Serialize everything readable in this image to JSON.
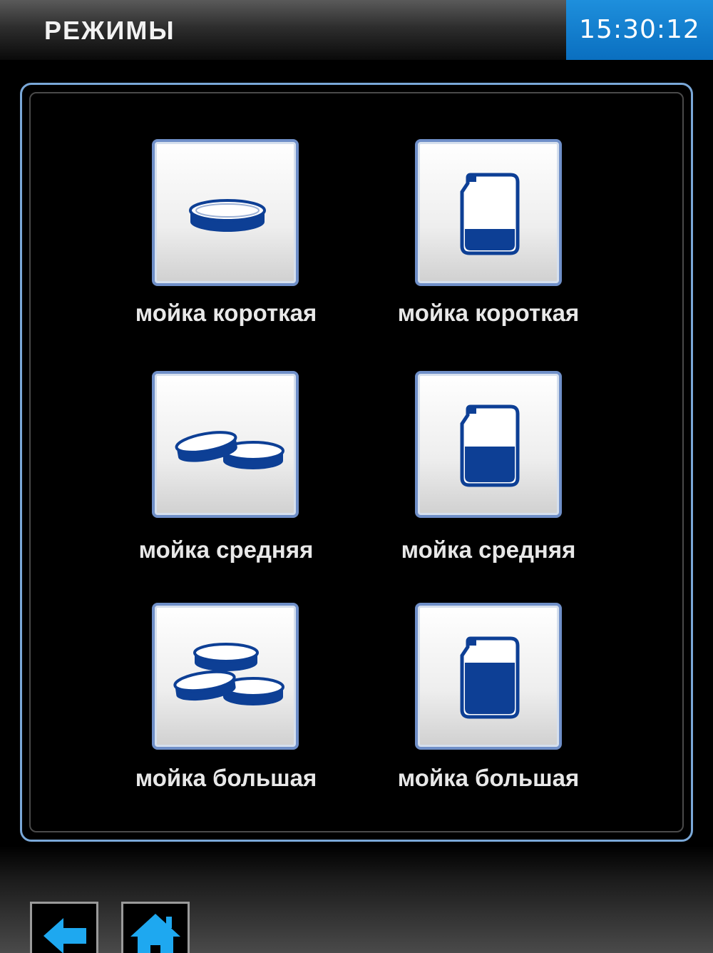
{
  "header": {
    "title": "РЕЖИМЫ",
    "clock": "15:30:12"
  },
  "modes": [
    {
      "label": "мойка короткая",
      "icon": "single-dish-icon"
    },
    {
      "label": "мойка короткая",
      "icon": "canister-low-icon"
    },
    {
      "label": "мойка средняя",
      "icon": "two-dishes-icon"
    },
    {
      "label": "мойка средняя",
      "icon": "canister-half-icon"
    },
    {
      "label": "мойка большая",
      "icon": "three-dishes-icon"
    },
    {
      "label": "мойка большая",
      "icon": "canister-full-icon"
    }
  ],
  "footer": {
    "back_icon": "back-arrow-icon",
    "home_icon": "home-icon"
  },
  "colors": {
    "accent": "#0a6fc0",
    "icon_blue": "#0d3f95",
    "nav_icon": "#1ea8f0",
    "tile_border": "#6f8fc8"
  }
}
